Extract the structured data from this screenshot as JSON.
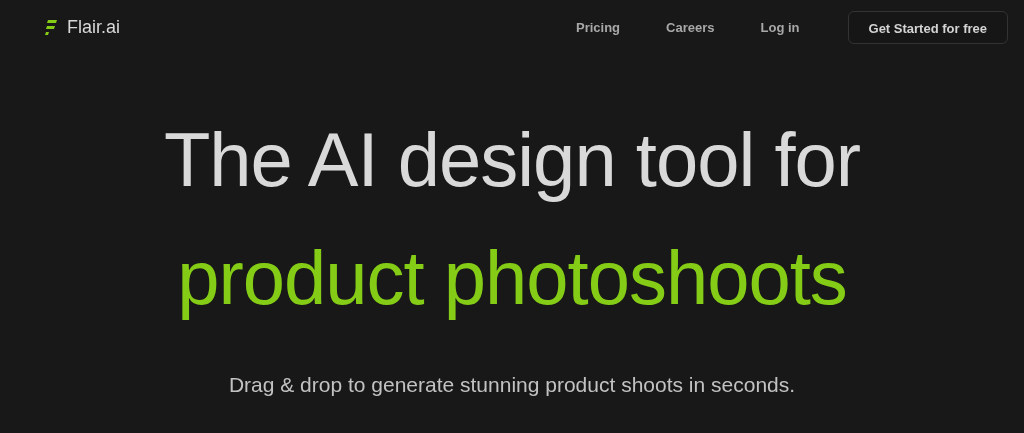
{
  "logo": {
    "text": "Flair.ai"
  },
  "nav": {
    "links": [
      "Pricing",
      "Careers",
      "Log in"
    ],
    "cta": "Get Started for free"
  },
  "hero": {
    "title_line_1": "The AI design tool for",
    "title_line_2": "product photoshoots",
    "subtitle": "Drag & drop to generate stunning product shoots in seconds."
  }
}
